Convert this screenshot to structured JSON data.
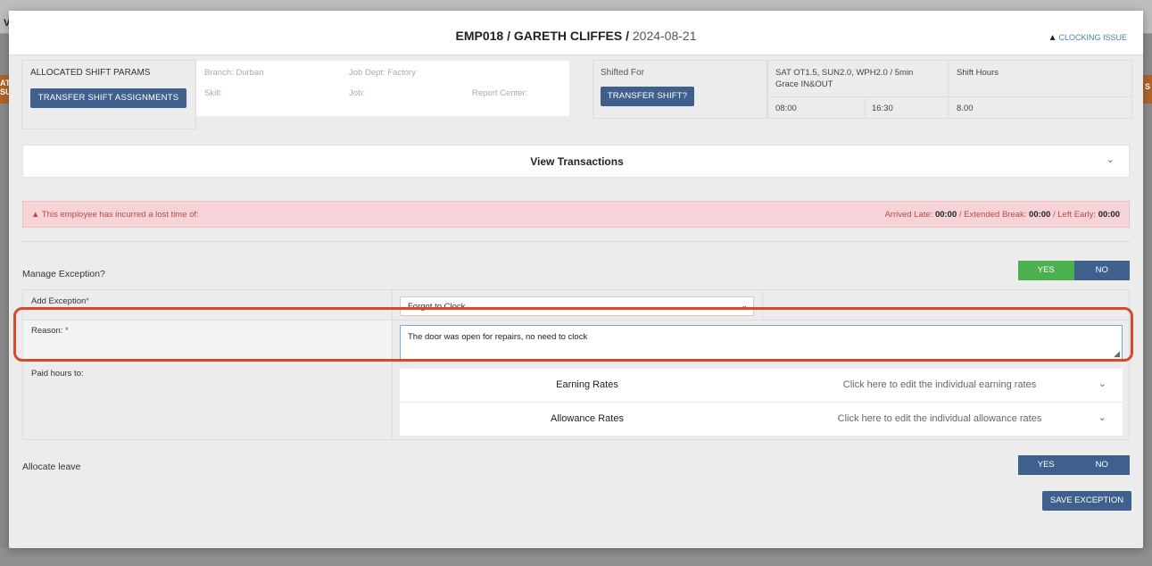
{
  "background": {
    "top_letter": "V",
    "left_tab": "AT SU",
    "right_tab": "S"
  },
  "modal": {
    "title_code_name": "EMP018 / GARETH CLIFFES /",
    "title_date": "2024-08-21",
    "clocking_issue": "CLOCKING ISSUE",
    "warning_glyph": "▲"
  },
  "shift_params": {
    "allocated_label": "ALLOCATED SHIFT PARAMS",
    "transfer_assignments_button": "TRANSFER SHIFT ASSIGNMENTS",
    "branch": "Branch: Durban",
    "job_dept": "Job Dept: Factory",
    "skill": "Skill:",
    "job": "Job:",
    "report_center": "Report Center:",
    "shifted_for_label": "Shifted For",
    "transfer_shift_button": "TRANSFER SHIFT?",
    "shift_name": "SAT OT1.5, SUN2.0, WPH2.0 / 5min Grace IN&OUT",
    "shift_hours_label": "Shift Hours",
    "start": "08:00",
    "end": "16:30",
    "hours": "8.00"
  },
  "transactions": {
    "label": "View Transactions",
    "chevron": "⌄"
  },
  "alert": {
    "message": "This employee has incurred a lost time of:",
    "arrived_late_label": "Arrived Late: ",
    "arrived_late_value": "00:00",
    "extended_break_label": " / Extended Break: ",
    "extended_break_value": "00:00",
    "left_early_label": " / Left Early: ",
    "left_early_value": "00:00"
  },
  "manage_exception": {
    "label": "Manage Exception?",
    "yes": "YES",
    "no": "NO",
    "selected": "YES"
  },
  "exception_form": {
    "add_exception_label": "Add Exception",
    "add_exception_value": "Forgot to Clock",
    "reason_label": "Reason: ",
    "reason_value": "The door was open for repairs, no need to clock",
    "paid_hours_label": "Paid hours to:",
    "required_mark": "*",
    "earning_rates": {
      "name": "Earning Rates",
      "description": "Click here to edit the individual earning rates"
    },
    "allowance_rates": {
      "name": "Allowance Rates",
      "description": "Click here to edit the individual allowance rates"
    }
  },
  "allocate_leave": {
    "label": "Allocate leave",
    "yes": "YES",
    "no": "NO"
  },
  "save_button": "SAVE EXCEPTION",
  "colors": {
    "primary_button": "#3f5f8c",
    "yes_active": "#4caf50",
    "alert_bg": "#f6d3d6",
    "highlight_outline": "#d9482b"
  }
}
